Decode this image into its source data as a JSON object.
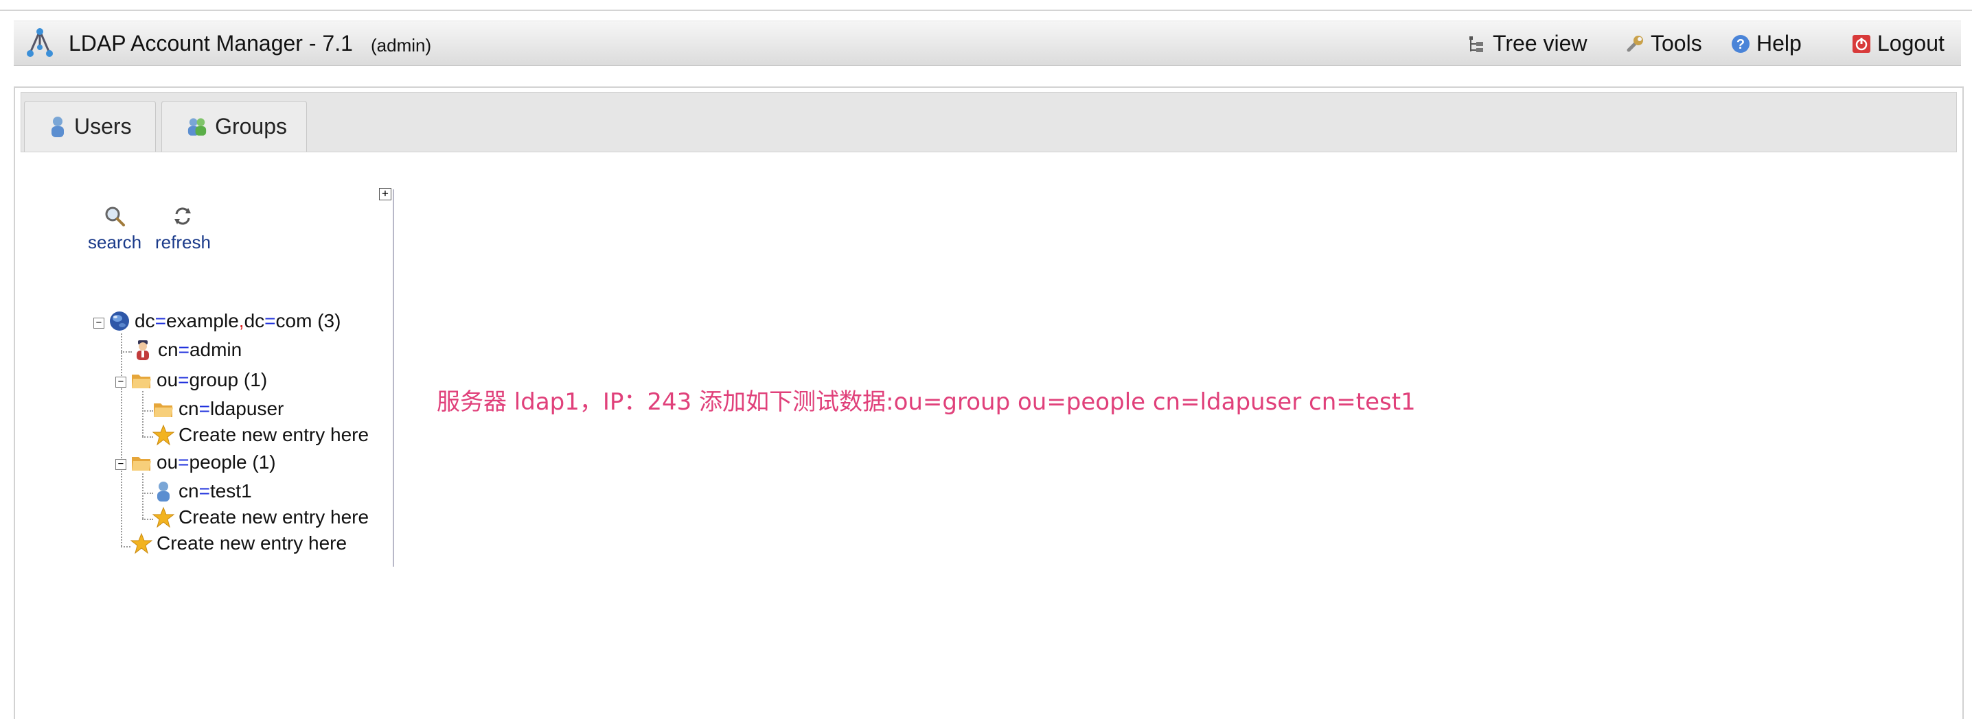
{
  "header": {
    "app_title": "LDAP Account Manager - 7.1",
    "user": "(admin)",
    "nav": {
      "tree_view": "Tree view",
      "tools": "Tools",
      "help": "Help",
      "logout": "Logout"
    }
  },
  "tabs": {
    "users": "Users",
    "groups": "Groups"
  },
  "toolbar": {
    "search": "search",
    "refresh": "refresh"
  },
  "tree": {
    "root": {
      "k1": "dc",
      "v1": "example",
      "k2": "dc",
      "v2": "com",
      "count": "(3)"
    },
    "admin": {
      "k": "cn",
      "v": "admin"
    },
    "group": {
      "k": "ou",
      "v": "group",
      "count": "(1)"
    },
    "ldapuser": {
      "k": "cn",
      "v": "ldapuser"
    },
    "create_group": "Create new entry here",
    "people": {
      "k": "ou",
      "v": "people",
      "count": "(1)"
    },
    "test1": {
      "k": "cn",
      "v": "test1"
    },
    "create_people": "Create new entry here",
    "create_root": "Create new entry here"
  },
  "note": "服务器 ldap1，IP：243 添加如下测试数据:ou=group ou=people cn=ldapuser cn=test1",
  "colors": {
    "note": "#e0407a",
    "eq": "#2233dd",
    "comma": "#dd2222",
    "tool_label": "#1a3a8a"
  }
}
